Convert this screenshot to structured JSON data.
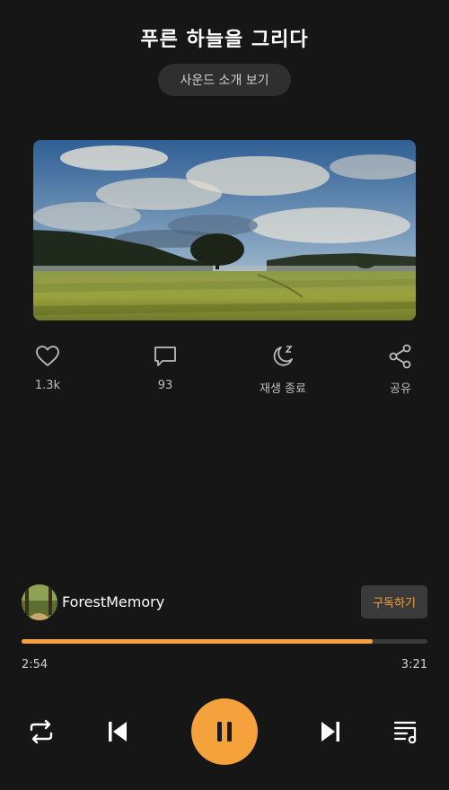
{
  "header": {
    "title": "푸른 하늘을 그리다",
    "intro_button": "사운드 소개 보기"
  },
  "actions": {
    "like": {
      "icon": "heart-icon",
      "label": "1.3k"
    },
    "comment": {
      "icon": "comment-icon",
      "label": "93"
    },
    "sleep_timer": {
      "icon": "moon-sleep-icon",
      "label": "재생 종료"
    },
    "share": {
      "icon": "share-icon",
      "label": "공유"
    }
  },
  "artist": {
    "name": "ForestMemory",
    "subscribe_label": "구독하기"
  },
  "player": {
    "current_time": "2:54",
    "total_time": "3:21",
    "progress": 0.865,
    "accent_color": "#f5a13c",
    "controls": [
      "repeat-icon",
      "previous-icon",
      "pause-icon",
      "next-icon",
      "playlist-icon"
    ]
  }
}
